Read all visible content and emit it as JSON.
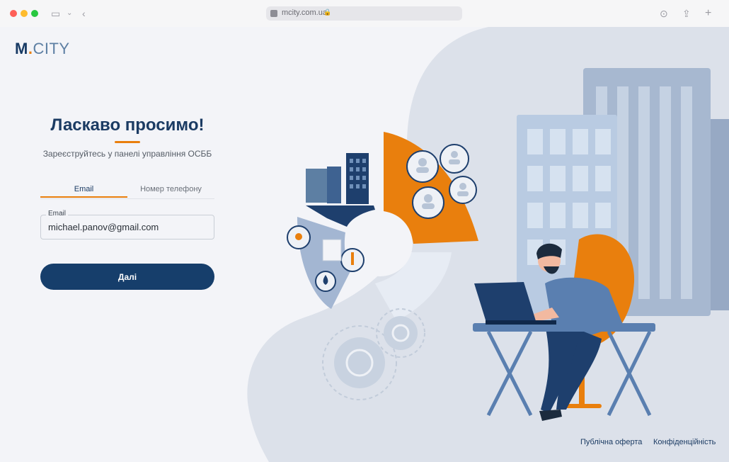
{
  "browser": {
    "url": "mcity.com.ua"
  },
  "logo": {
    "m": "M",
    "dot": ".",
    "city": "CITY"
  },
  "login": {
    "title": "Ласкаво просимо!",
    "subtitle": "Зареєструйтесь у панелі управління ОСББ",
    "tabs": {
      "email": "Email",
      "phone": "Номер телефону"
    },
    "email_field": {
      "label": "Email",
      "value": "michael.panov@gmail.com"
    },
    "next_button": "Далі"
  },
  "footer": {
    "offer": "Публічна оферта",
    "privacy": "Конфіденційність"
  },
  "colors": {
    "primary": "#163e6b",
    "accent": "#e97f0d",
    "background": "#f3f4f8"
  }
}
